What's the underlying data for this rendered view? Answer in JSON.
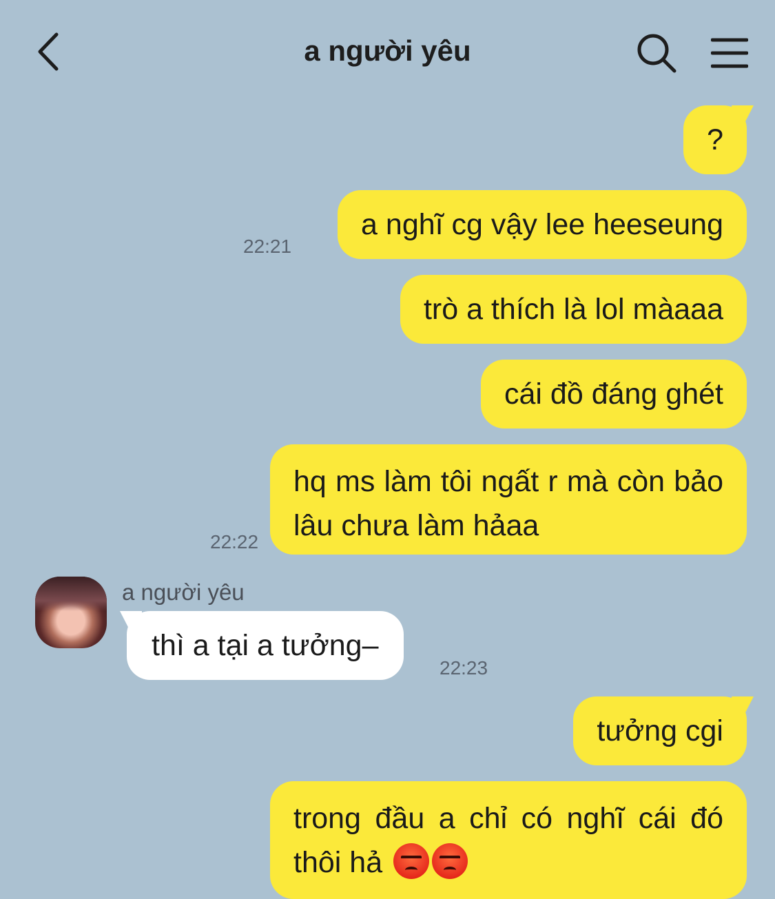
{
  "header": {
    "title": "a người yêu",
    "icons": {
      "back": "chevron-left-icon",
      "search": "search-icon",
      "menu": "menu-icon"
    }
  },
  "colors": {
    "background": "#abc1d1",
    "my_bubble": "#fbe93a",
    "their_bubble": "#ffffff",
    "time": "#5a6470"
  },
  "messages": [
    {
      "from": "me",
      "text": "?"
    },
    {
      "from": "me",
      "text": "a nghĩ cg vậy lee heeseung",
      "time": "22:21"
    },
    {
      "from": "me",
      "text": "trò a thích là lol màaaa"
    },
    {
      "from": "me",
      "text": "cái đồ đáng ghét"
    },
    {
      "from": "me",
      "text": "hq ms làm tôi ngất r mà còn bảo lâu chưa làm hảaa",
      "time": "22:22"
    },
    {
      "from": "them",
      "sender": "a người yêu",
      "text": "thì a tại a tưởng–",
      "time": "22:23"
    },
    {
      "from": "me",
      "text": "tưởng cgi"
    },
    {
      "from": "me",
      "text": "trong đầu a chỉ có nghĩ cái đó thôi hả",
      "emoji": [
        "angry-face-icon",
        "angry-face-icon"
      ]
    }
  ]
}
